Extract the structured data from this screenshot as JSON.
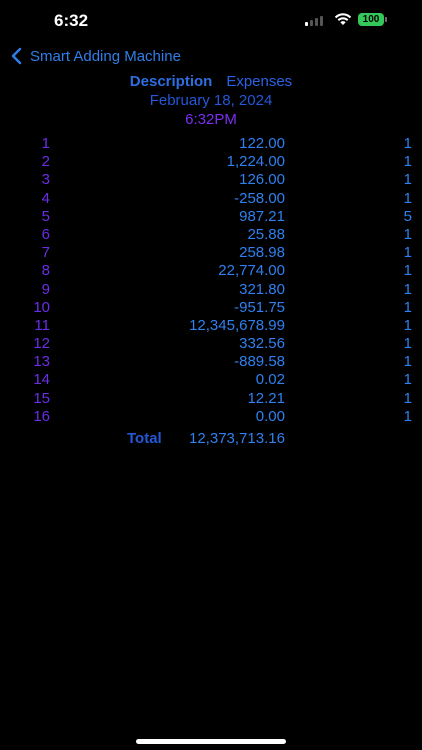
{
  "status_bar": {
    "time": "6:32",
    "battery_level": "100",
    "battery_color": "#34c759",
    "signal_bars_active": 1,
    "signal_bars_total": 4
  },
  "nav": {
    "back_label": "Smart Adding Machine",
    "back_icon": "chevron-left-icon",
    "accent_color": "#2f7fea"
  },
  "header": {
    "description_label": "Description",
    "description_value": "Expenses",
    "date": "February 18, 2024",
    "time": "6:32PM"
  },
  "entries": [
    {
      "index": "1",
      "amount": "122.00",
      "qty": "1"
    },
    {
      "index": "2",
      "amount": "1,224.00",
      "qty": "1"
    },
    {
      "index": "3",
      "amount": "126.00",
      "qty": "1"
    },
    {
      "index": "4",
      "amount": "-258.00",
      "qty": "1"
    },
    {
      "index": "5",
      "amount": "987.21",
      "qty": "5"
    },
    {
      "index": "6",
      "amount": "25.88",
      "qty": "1"
    },
    {
      "index": "7",
      "amount": "258.98",
      "qty": "1"
    },
    {
      "index": "8",
      "amount": "22,774.00",
      "qty": "1"
    },
    {
      "index": "9",
      "amount": "321.80",
      "qty": "1"
    },
    {
      "index": "10",
      "amount": "-951.75",
      "qty": "1"
    },
    {
      "index": "11",
      "amount": "12,345,678.99",
      "qty": "1"
    },
    {
      "index": "12",
      "amount": "332.56",
      "qty": "1"
    },
    {
      "index": "13",
      "amount": "-889.58",
      "qty": "1"
    },
    {
      "index": "14",
      "amount": "0.02",
      "qty": "1"
    },
    {
      "index": "15",
      "amount": "12.21",
      "qty": "1"
    },
    {
      "index": "16",
      "amount": "0.00",
      "qty": "1"
    }
  ],
  "total": {
    "label": "Total",
    "value": "12,373,713.16"
  }
}
